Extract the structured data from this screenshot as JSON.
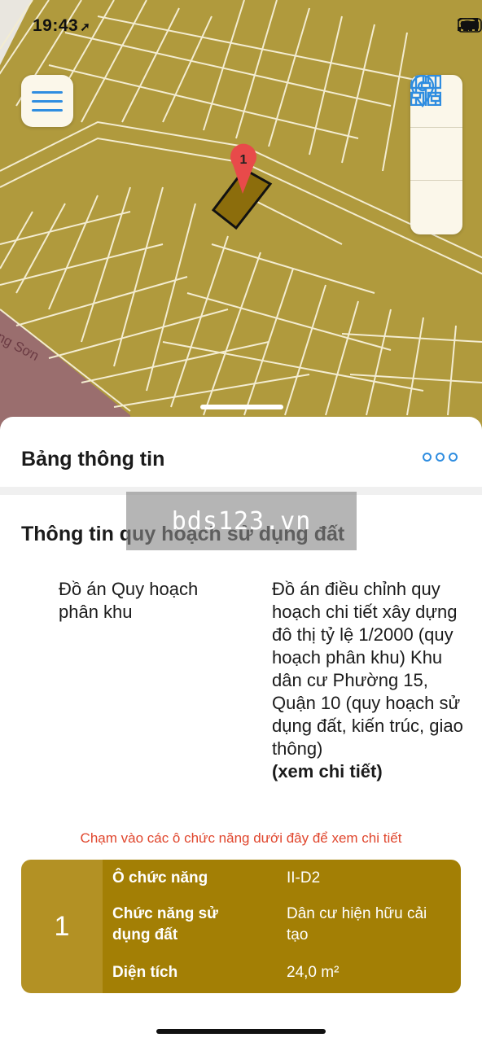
{
  "status_bar": {
    "time": "19:43",
    "location_arrow": "➚"
  },
  "map": {
    "street_label": "ng Sơn",
    "marker_number": "1",
    "colors": {
      "land": "#b09a3d",
      "parcel_lines": "#f3ecd0",
      "selected_parcel": "#8c6d0c",
      "road": "#9a6e6e",
      "marker": "#e84a4a"
    }
  },
  "toolbar": {
    "menu_icon": "hamburger-menu-icon",
    "tools": [
      "grid-layers-icon",
      "location-pin-icon",
      "filter-sliders-icon"
    ]
  },
  "sheet": {
    "title": "Bảng thông tin",
    "more_icon": "more-dots-icon",
    "watermark": "bds123.vn",
    "section_title": "Thông tin quy hoạch sử dụng đất",
    "plan_label": "Đồ án Quy hoạch phân khu",
    "plan_value": "Đồ án điều chỉnh quy hoạch chi tiết xây dựng đô thị tỷ lệ 1/2000 (quy hoạch phân khu) Khu dân cư Phường 15, Quận 10 (quy hoạch sử dụng đất, kiến trúc, giao thông)",
    "plan_link": "(xem chi tiết)",
    "hint": "Chạm vào các ô chức năng dưới đây để xem chi tiết"
  },
  "card": {
    "number": "1",
    "rows": [
      {
        "label": "Ô chức năng",
        "value": "II-D2"
      },
      {
        "label": "Chức năng sử dụng đất",
        "value": "Dân cư hiện hữu cải tạo"
      },
      {
        "label": "Diện tích",
        "value": "24,0 m²"
      }
    ],
    "colors": {
      "number_bg": "#b39124",
      "rows_bg": "#a37f05"
    }
  }
}
